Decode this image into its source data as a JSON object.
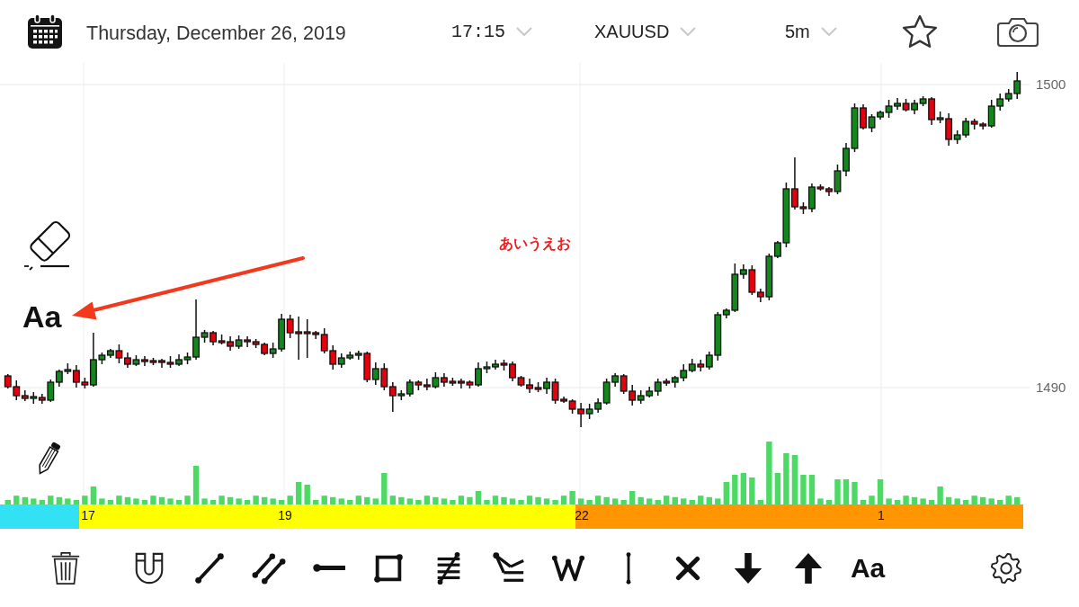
{
  "header": {
    "date": "Thursday, December 26, 2019",
    "time": "17:15",
    "symbol": "XAUUSD",
    "interval": "5m"
  },
  "side_tools": {
    "text_tool": "Aa"
  },
  "chart": {
    "annotations": [
      {
        "kind": "arrow"
      },
      {
        "kind": "text",
        "text": "あいうえお"
      }
    ],
    "price_axis": {
      "labels": [
        "1500",
        "1490"
      ]
    }
  },
  "time_strip": {
    "segments": [
      {
        "color": "#33e1f5"
      },
      {
        "color": "#ffff00",
        "labels": [
          "17",
          "19"
        ]
      },
      {
        "color": "#ff9500",
        "labels": [
          "22",
          "1"
        ]
      }
    ]
  },
  "drawing_toolbar": {
    "text_tool": "Aa"
  }
}
